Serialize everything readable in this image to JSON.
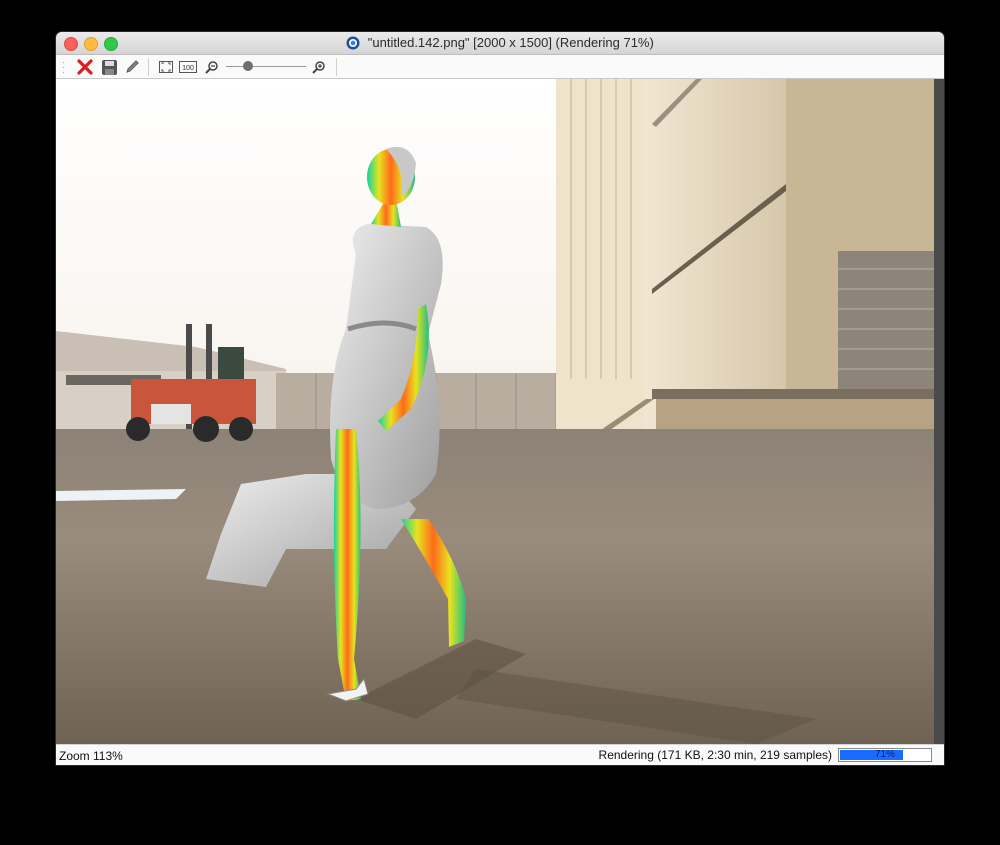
{
  "window": {
    "title": "\"untitled.142.png\" [2000 x 1500] (Rendering 71%)",
    "app_icon": "blender-icon"
  },
  "toolbar": {
    "buttons": [
      {
        "name": "stop-render-icon",
        "color": "#e01b1b"
      },
      {
        "name": "save-icon"
      },
      {
        "name": "edit-pencil-icon"
      },
      {
        "name": "fit-to-window-icon"
      },
      {
        "name": "actual-size-100-icon",
        "label": "100"
      },
      {
        "name": "zoom-out-icon"
      },
      {
        "name": "zoom-in-icon"
      }
    ],
    "zoom_slider_level": 0.28
  },
  "status": {
    "zoom": "Zoom 113%",
    "render_info": "Rendering (171 KB, 2:30 min, 219 samples)",
    "progress_value": 71,
    "progress_label": "71%"
  },
  "colors": {
    "progress_fill": "#1a6bff",
    "close": "#fc605c",
    "minimize": "#fdbc40",
    "maximize": "#34c84a"
  }
}
